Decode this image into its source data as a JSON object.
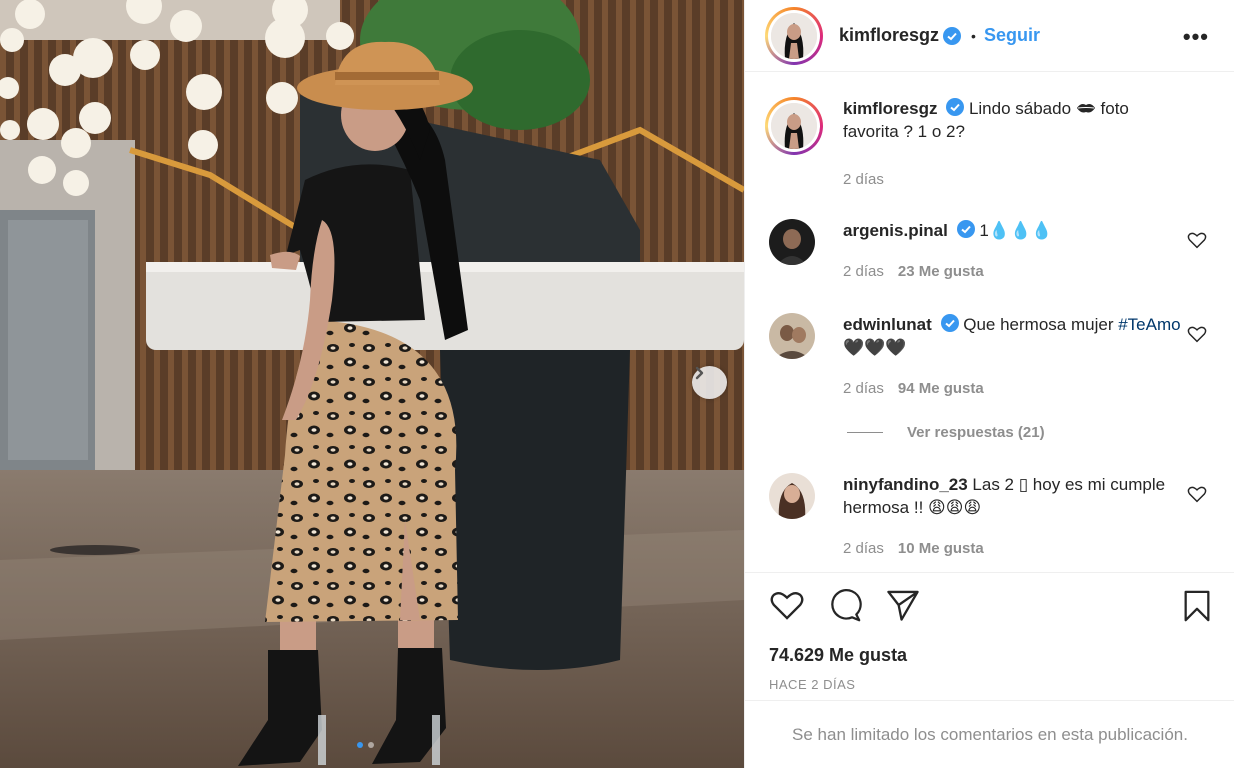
{
  "post": {
    "author": "kimfloresgz",
    "follow_label": "Seguir",
    "separator": "•",
    "more_label": "•••"
  },
  "caption": {
    "author": "kimfloresgz",
    "text_1": "Lindo sábado",
    "text_2": "foto favorita ? 1 o 2?",
    "time": "2 días"
  },
  "comments": [
    {
      "user": "argenis.pinal",
      "text": "1💧💧💧",
      "time": "2 días",
      "likes": "23 Me gusta"
    },
    {
      "user": "edwinlunat",
      "text": "Que hermosa mujer",
      "hashtag": "#TeAmo",
      "hearts": "🖤🖤🖤",
      "time": "2 días",
      "likes": "94 Me gusta"
    },
    {
      "user": "ninyfandino_23",
      "text": "Las 2 ▯ hoy es mi cumple hermosa !! 😩😩😩",
      "time": "2 días",
      "likes": "10 Me gusta"
    }
  ],
  "replies_label": "Ver respuestas (21)",
  "likes_total": "74.629 Me gusta",
  "posted_when": "HACE 2 DÍAS",
  "comments_limited": "Se han limitado los comentarios en esta publicación.",
  "carousel": {
    "total": 2,
    "current": 1
  },
  "colors": {
    "link": "#3897f0",
    "text": "#262626",
    "muted": "#8e8e8e",
    "verified": "#3897f0"
  }
}
